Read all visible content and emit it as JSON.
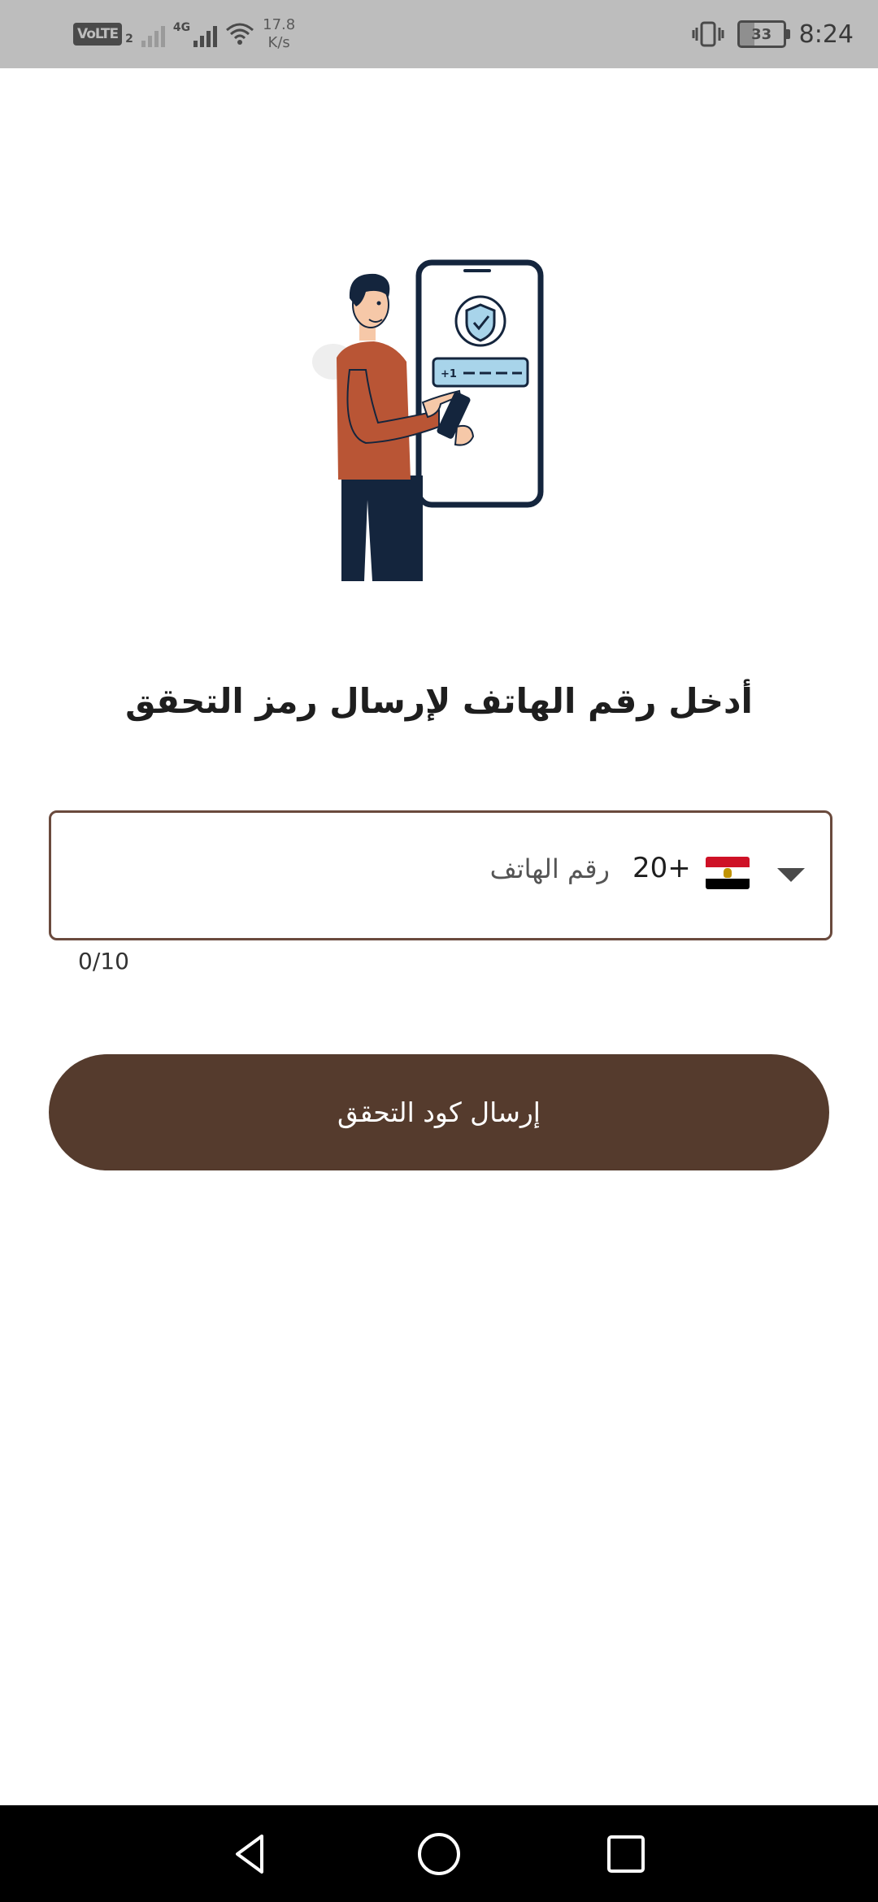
{
  "status_bar": {
    "volte": "VoLTE",
    "sim_slot": "2",
    "network_type": "4G",
    "speed_value": "17.8",
    "speed_unit": "K/s",
    "battery_level": "33",
    "time": "8:24"
  },
  "illustration": {
    "code_prefix": "+1",
    "icon": "person-with-phone-verification-illustration"
  },
  "heading": "أدخل رقم الهاتف لإرسال رمز التحقق",
  "phone_field": {
    "country_flag": "egypt-flag",
    "dial_code": "+20",
    "placeholder": "رقم الهاتف",
    "counter": "0/10"
  },
  "send_button": "إرسال كود التحقق",
  "colors": {
    "primary": "#553b2d",
    "field_border": "#6a4a3d",
    "status_bar_bg": "#bdbdbd"
  }
}
